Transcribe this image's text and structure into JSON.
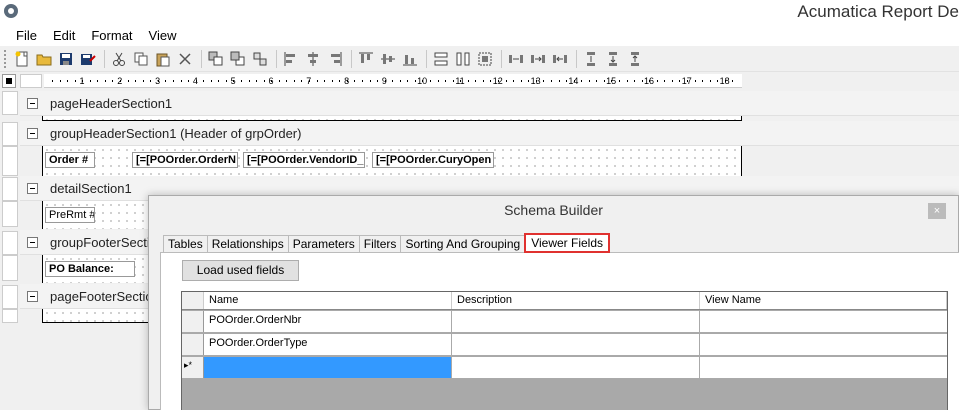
{
  "window": {
    "title": "Acumatica Report De"
  },
  "menu": [
    "File",
    "Edit",
    "Format",
    "View"
  ],
  "toolbar": {
    "icons": [
      "new-report-icon",
      "open-icon",
      "save-icon",
      "save-as-icon",
      "cut-icon",
      "copy-icon",
      "paste-icon",
      "delete-icon",
      "send-to-back-icon",
      "bring-to-front-icon",
      "group-icon",
      "align-left-icon",
      "align-center-icon",
      "align-right-icon",
      "align-top-icon",
      "align-middle-icon",
      "align-bottom-icon",
      "same-width-icon",
      "same-height-icon",
      "same-size-icon",
      "horizontal-spacing-icon",
      "increase-hspacing-icon",
      "decrease-hspacing-icon",
      "vertical-spacing-icon",
      "increase-vspacing-icon",
      "decrease-vspacing-icon"
    ]
  },
  "ruler": {
    "labels": [
      "1",
      "2",
      "3",
      "4",
      "5",
      "6",
      "7",
      "8",
      "9",
      "10",
      "11",
      "12",
      "13",
      "14",
      "15",
      "16",
      "17",
      "18"
    ]
  },
  "sections": {
    "page_header": "pageHeaderSection1",
    "group_header": "groupHeaderSection1 (Header of grpOrder)",
    "detail": "detailSection1",
    "group_footer": "groupFooterSectio",
    "page_footer": "pageFooterSectio"
  },
  "design_fields": {
    "order_label": "Order #",
    "order_nbr": "[=[POOrder.OrderN",
    "vendor_id": "[=[POOrder.VendorID_",
    "cury_open": "[=[POOrder.CuryOpen",
    "prerm": "PreRmt #",
    "po_balance": "PO Balance:"
  },
  "dialog": {
    "title": "Schema Builder",
    "close_glyph": "×",
    "tabs": [
      "Tables",
      "Relationships",
      "Parameters",
      "Filters",
      "Sorting And Grouping",
      "Viewer Fields"
    ],
    "active_tab": "Viewer Fields",
    "load_button": "Load used fields",
    "grid": {
      "columns": [
        "Name",
        "Description",
        "View Name"
      ],
      "rows": [
        {
          "name": "POOrder.OrderNbr",
          "description": "",
          "view_name": ""
        },
        {
          "name": "POOrder.OrderType",
          "description": "",
          "view_name": ""
        }
      ],
      "new_row_marker": "▸*"
    }
  },
  "colors": {
    "active_tab_border": "#e0312f",
    "selection": "#3399ff",
    "grid_empty": "#a9a9a9"
  }
}
